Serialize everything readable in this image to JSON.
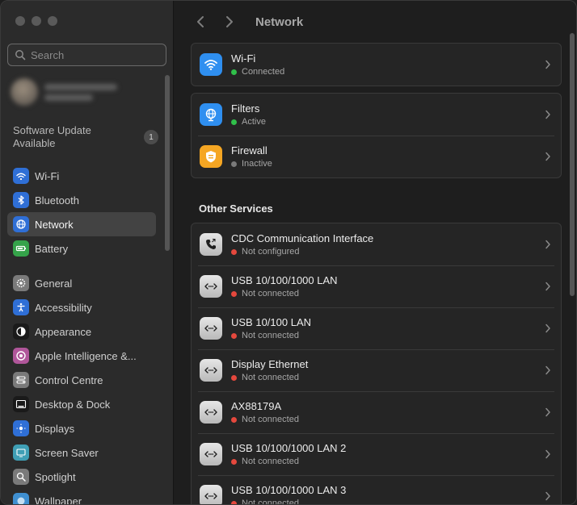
{
  "window": {
    "title": "Network"
  },
  "search": {
    "placeholder": "Search"
  },
  "software_update": {
    "label": "Software Update Available",
    "badge": "1"
  },
  "sidebar": {
    "items": [
      {
        "label": "Wi-Fi",
        "icon": "wifi-icon",
        "color": "#2f6fd6"
      },
      {
        "label": "Bluetooth",
        "icon": "bluetooth-icon",
        "color": "#2f6fd6"
      },
      {
        "label": "Network",
        "icon": "globe-icon",
        "color": "#2f6fd6",
        "active": true
      },
      {
        "label": "Battery",
        "icon": "battery-icon",
        "color": "#35a34a"
      },
      {
        "label": "General",
        "icon": "gear-icon",
        "color": "#7a7a7a"
      },
      {
        "label": "Accessibility",
        "icon": "accessibility-icon",
        "color": "#2f6fd6"
      },
      {
        "label": "Appearance",
        "icon": "appearance-icon",
        "color": "#1a1a1a"
      },
      {
        "label": "Apple Intelligence &...",
        "icon": "apple-intelligence-icon",
        "color": "#b0569a"
      },
      {
        "label": "Control Centre",
        "icon": "control-centre-icon",
        "color": "#7a7a7a"
      },
      {
        "label": "Desktop & Dock",
        "icon": "dock-icon",
        "color": "#1a1a1a"
      },
      {
        "label": "Displays",
        "icon": "displays-icon",
        "color": "#2f6fd6"
      },
      {
        "label": "Screen Saver",
        "icon": "screen-saver-icon",
        "color": "#3f9fb5"
      },
      {
        "label": "Spotlight",
        "icon": "spotlight-icon",
        "color": "#7a7a7a"
      },
      {
        "label": "Wallpaper",
        "icon": "wallpaper-icon",
        "color": "#3f8fd0"
      }
    ]
  },
  "main": {
    "wifi": {
      "name": "Wi-Fi",
      "status": "Connected",
      "status_color": "#30c04a"
    },
    "security": [
      {
        "name": "Filters",
        "status": "Active",
        "status_color": "#30c04a",
        "icon": "filters-globe-icon",
        "color": "#2f8ff0"
      },
      {
        "name": "Firewall",
        "status": "Inactive",
        "status_color": "#7a7a7a",
        "icon": "firewall-shield-icon",
        "color": "#f5a623"
      }
    ],
    "other_services_title": "Other Services",
    "services": [
      {
        "name": "CDC Communication Interface",
        "status": "Not configured",
        "icon": "phone-icon"
      },
      {
        "name": "USB 10/100/1000 LAN",
        "status": "Not connected",
        "icon": "ethernet-icon"
      },
      {
        "name": "USB 10/100 LAN",
        "status": "Not connected",
        "icon": "ethernet-icon"
      },
      {
        "name": "Display Ethernet",
        "status": "Not connected",
        "icon": "ethernet-icon"
      },
      {
        "name": "AX88179A",
        "status": "Not connected",
        "icon": "ethernet-icon"
      },
      {
        "name": "USB 10/100/1000 LAN 2",
        "status": "Not connected",
        "icon": "ethernet-icon"
      },
      {
        "name": "USB 10/100/1000 LAN 3",
        "status": "Not connected",
        "icon": "ethernet-icon"
      }
    ],
    "not_ok_color": "#e5483d"
  }
}
